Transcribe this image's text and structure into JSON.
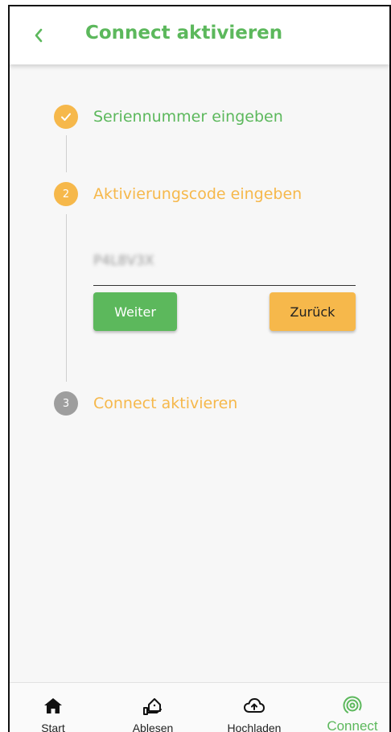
{
  "header": {
    "title": "Connect aktivieren"
  },
  "steps": [
    {
      "number": "✓",
      "label": "Seriennummer eingeben"
    },
    {
      "number": "2",
      "label": "Aktivierungscode eingeben"
    },
    {
      "number": "3",
      "label": "Connect aktivieren"
    }
  ],
  "form": {
    "code_value": "P4L8V3X",
    "next_label": "Weiter",
    "back_label": "Zurück"
  },
  "nav": {
    "items": [
      {
        "label": "Start",
        "icon": "home-icon"
      },
      {
        "label": "Ablesen",
        "icon": "meter-reading-icon"
      },
      {
        "label": "Hochladen",
        "icon": "cloud-upload-icon"
      },
      {
        "label": "Connect",
        "icon": "connect-signal-icon",
        "active": true
      }
    ]
  },
  "colors": {
    "green": "#5cb85c",
    "orange": "#f6b84b",
    "grey": "#9e9e9e"
  }
}
